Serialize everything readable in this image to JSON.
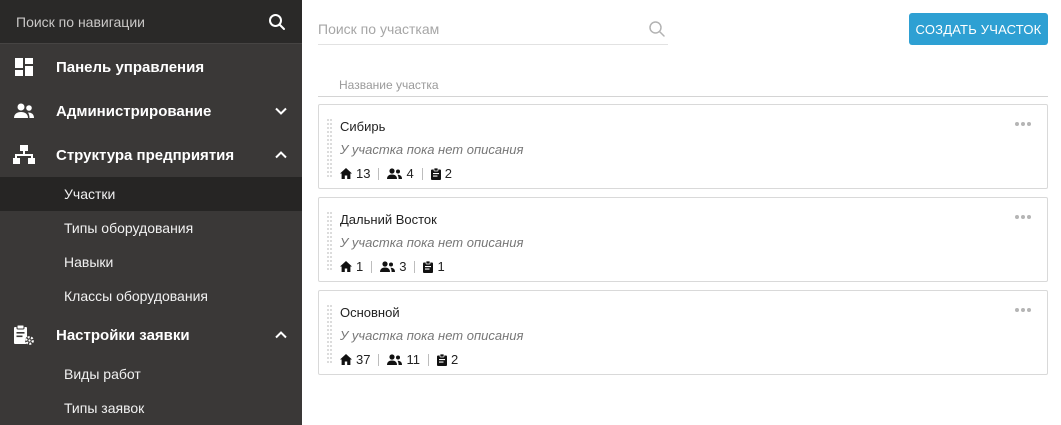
{
  "sidebar": {
    "search_placeholder": "Поиск по навигации",
    "sections": {
      "dashboard": {
        "label": "Панель управления",
        "icon": "dashboard-icon"
      },
      "admin": {
        "label": "Администрирование",
        "icon": "users-icon",
        "expanded": false
      },
      "structure": {
        "label": "Структура предприятия",
        "icon": "org-structure-icon",
        "expanded": true,
        "items": [
          "Участки",
          "Типы оборудования",
          "Навыки",
          "Классы оборудования"
        ],
        "active_index": 0
      },
      "request_settings": {
        "label": "Настройки заявки",
        "icon": "clipboard-gear-icon",
        "expanded": true,
        "items": [
          "Виды работ",
          "Типы заявок"
        ]
      }
    }
  },
  "main": {
    "search_placeholder": "Поиск по участкам",
    "create_button": "СОЗДАТЬ УЧАСТОК",
    "column_header": "Название участка",
    "areas": [
      {
        "name": "Сибирь",
        "description": "У участка пока нет описания",
        "houses": "13",
        "users": "4",
        "tasks": "2"
      },
      {
        "name": "Дальний Восток",
        "description": "У участка пока нет описания",
        "houses": "1",
        "users": "3",
        "tasks": "1"
      },
      {
        "name": "Основной",
        "description": "У участка пока нет описания",
        "houses": "37",
        "users": "11",
        "tasks": "2"
      }
    ]
  },
  "colors": {
    "sidebar_bg": "#3a3837",
    "sidebar_active": "#262524",
    "accent": "#2ea0d3"
  }
}
